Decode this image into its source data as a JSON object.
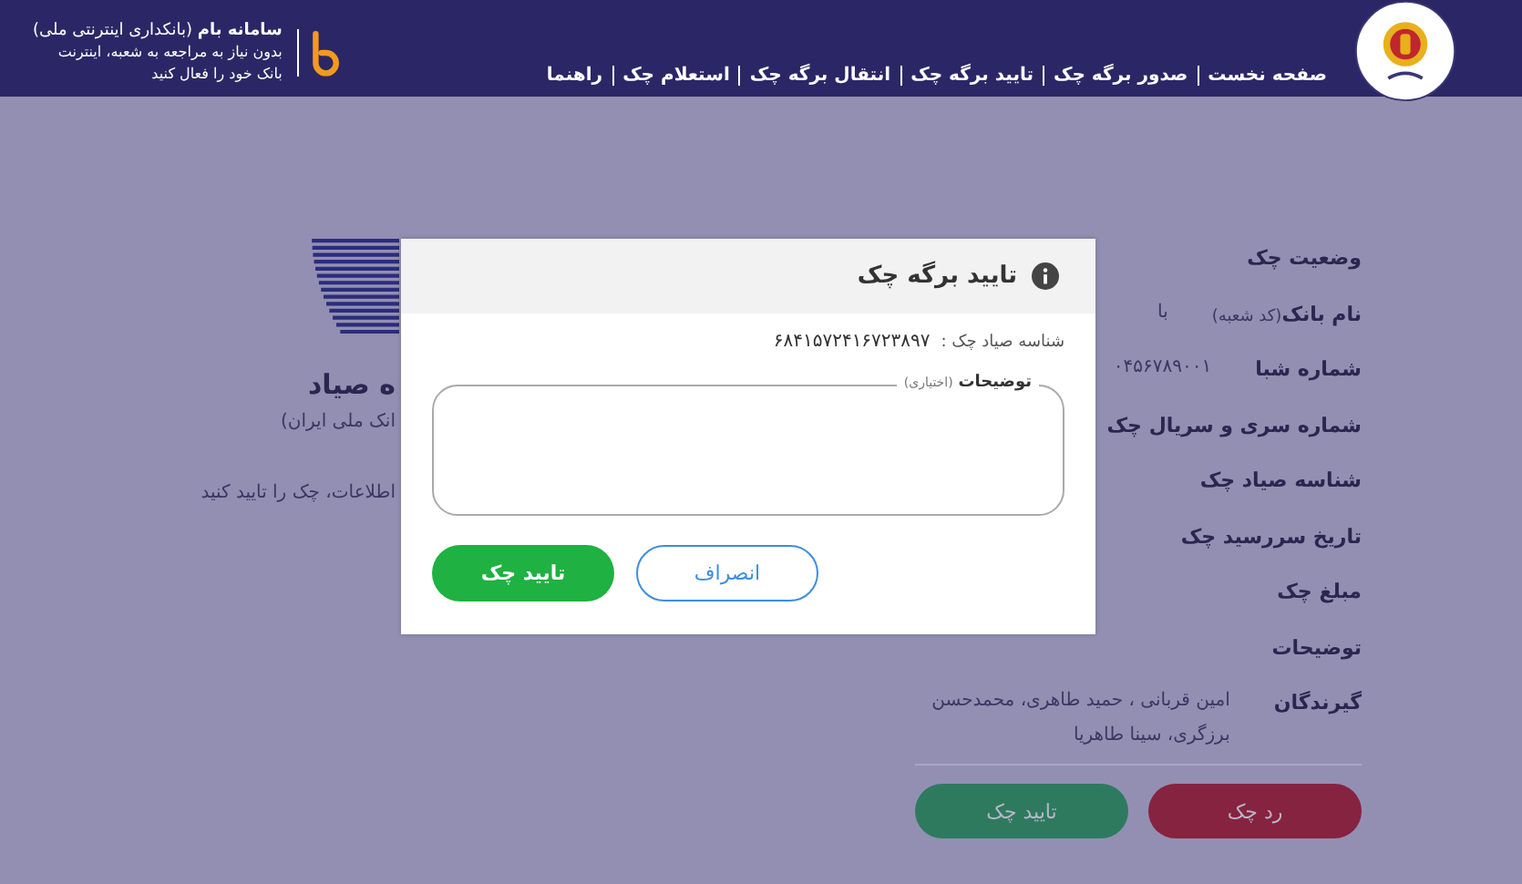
{
  "header": {
    "brand_title": "**سامانه بام** (بانکداری اینترنتی ملی)",
    "brand_lines": [
      "بدون نیاز به مراجعه به شعبه، اینترنت",
      "بانک خود را فعال کنید"
    ],
    "nav": [
      "صفحه نخست",
      "صدور برگه چک",
      "تایید برگه چک",
      "انتقال برگه چک",
      "استعلام چک",
      "راهنما"
    ]
  },
  "intro": {
    "title": "ه صیاد",
    "subtitle": "انک ملی ایران)",
    "text": "اطلاعات، چک را تایید کنید"
  },
  "details": [
    {
      "label": "وضعیت چک"
    },
    {
      "label": "نام بانک",
      "hint": "(کد شعبه)",
      "value": "با"
    },
    {
      "label": "شماره شبا",
      "value": "۰۴۵۶۷۸۹۰۰۱"
    },
    {
      "label": "شماره سری و سریال چک"
    },
    {
      "label": "شناسه صیاد چک"
    },
    {
      "label": "تاریخ سررسید چک"
    },
    {
      "label": "مبلغ چک"
    },
    {
      "label": "توضیحات"
    },
    {
      "label": "گیرندگان",
      "value": "امین قربانی ، حمید طاهری، محمدحسن برزگری، سینا طاهریا"
    }
  ],
  "actions": [
    {
      "label": "رد چک",
      "kind": "reject"
    },
    {
      "label": "تایید چک",
      "kind": "confirm"
    }
  ],
  "dialog": {
    "title": "تایید برگه چک",
    "id_label": "شناسه صیاد چک :",
    "id_value": "۶۸۴۱۵۷۲۴۱۶۷۲۳۸۹۷",
    "field_label": "توضیحات",
    "field_hint": "(اختیاری)",
    "buttons": [
      {
        "label": "انصراف",
        "kind": "cancel"
      },
      {
        "label": "تایید چک",
        "kind": "confirm"
      }
    ]
  }
}
